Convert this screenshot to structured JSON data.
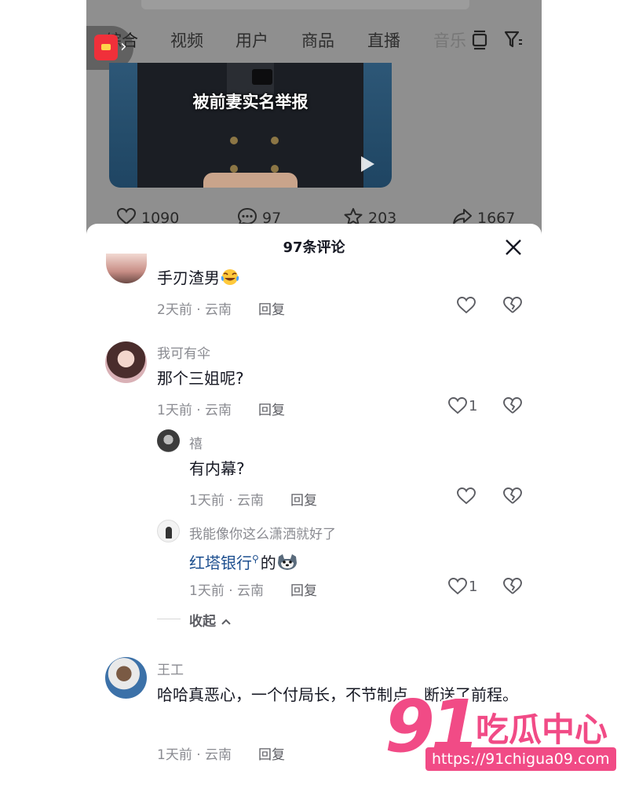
{
  "tabs": {
    "items": [
      "综合",
      "视频",
      "用户",
      "商品",
      "直播",
      "音乐"
    ],
    "active_index": 0
  },
  "video": {
    "caption": "被前妻实名举报"
  },
  "stats": {
    "likes": "1090",
    "comments": "97",
    "favorites": "203",
    "shares": "1667"
  },
  "sheet": {
    "title": "97条评论"
  },
  "comments": [
    {
      "text": "手刃渣男",
      "time_location": "2天前 · 云南",
      "reply_label": "回复",
      "likes": ""
    },
    {
      "username": "我可有伞",
      "text": "那个三姐呢?",
      "time_location": "1天前 · 云南",
      "reply_label": "回复",
      "likes": "1"
    },
    {
      "username": "王工",
      "text": "哈哈真恶心，一个付局长，不节制点。断送了前程。",
      "time_location": "1天前 · 云南",
      "reply_label": "回复",
      "likes": ""
    }
  ],
  "replies": [
    {
      "username": "禧",
      "text": "有内幕?",
      "time_location": "1天前 · 云南",
      "reply_label": "回复",
      "likes": ""
    },
    {
      "username": "我能像你这么潇洒就好了",
      "link_text": "红塔银行",
      "text_after_link": "的",
      "time_location": "1天前 · 云南",
      "reply_label": "回复",
      "likes": "1"
    }
  ],
  "collapse_label": "收起",
  "watermark": {
    "number": "91",
    "brand": "吃瓜中心",
    "url": "https://91chigua09.com"
  },
  "colors": {
    "text_primary": "#161823",
    "text_secondary": "#8a8b91",
    "link": "#1d4f8f",
    "watermark": "#f14b86"
  }
}
